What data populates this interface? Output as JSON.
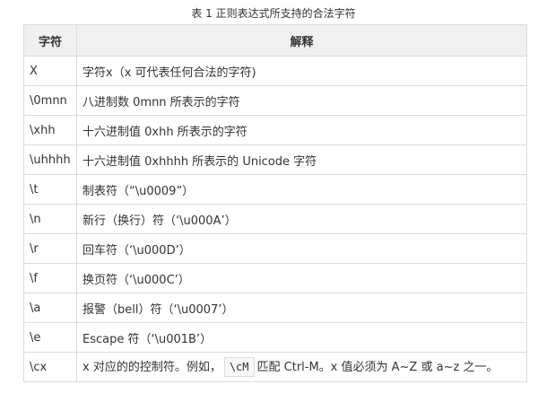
{
  "caption": "表 1 正则表达式所支持的合法字符",
  "table": {
    "headers": {
      "char": "字符",
      "desc": "解释"
    },
    "rows": [
      {
        "char": "X",
        "desc": "字符x（x 可代表任何合法的字符)"
      },
      {
        "char": "\\0mnn",
        "desc": "八进制数 0mnn 所表示的字符"
      },
      {
        "char": "\\xhh",
        "desc": "十六进制值 0xhh 所表示的字符"
      },
      {
        "char": "\\uhhhh",
        "desc": "十六进制值 0xhhhh 所表示的 Unicode 字符"
      },
      {
        "char": "\\t",
        "desc": "制表符（“\\u0009”）"
      },
      {
        "char": "\\n",
        "desc": "新行（换行）符（‘\\u000A’）"
      },
      {
        "char": "\\r",
        "desc": "回车符（‘\\u000D’）"
      },
      {
        "char": "\\f",
        "desc": "换页符（‘\\u000C’）"
      },
      {
        "char": "\\a",
        "desc": "报警（bell）符（‘\\u0007’）"
      },
      {
        "char": "\\e",
        "desc": "Escape 符（‘\\u001B’）"
      },
      {
        "char": "\\cx",
        "desc_prefix": "x 对应的的控制符。例如，",
        "desc_code": "\\cM",
        "desc_suffix": "匹配 Ctrl-M。x 值必须为 A~Z 或 a~z 之一。"
      }
    ]
  }
}
